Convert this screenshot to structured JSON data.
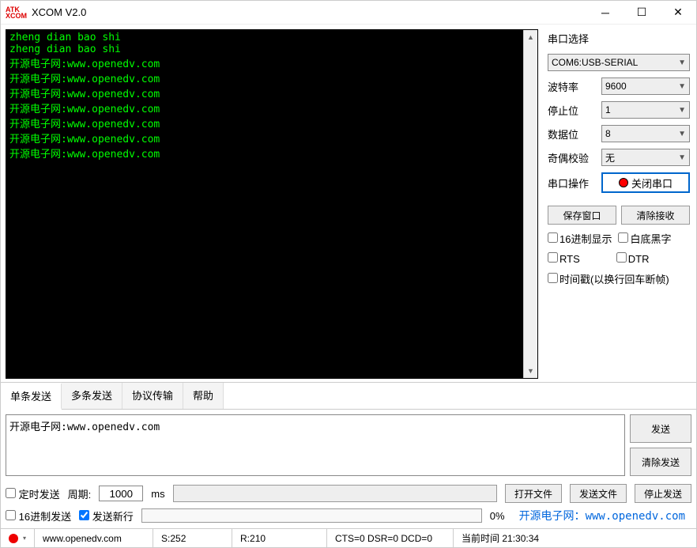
{
  "window": {
    "title": "XCOM V2.0",
    "logo_top": "ATK",
    "logo_bot": "XCOM"
  },
  "terminal_lines": [
    "zheng dian bao shi",
    "zheng dian bao shi",
    "开源电子网:www.openedv.com",
    "开源电子网:www.openedv.com",
    "开源电子网:www.openedv.com",
    "开源电子网:www.openedv.com",
    "开源电子网:www.openedv.com",
    "开源电子网:www.openedv.com",
    "开源电子网:www.openedv.com"
  ],
  "sidebar": {
    "title": "串口选择",
    "port": "COM6:USB-SERIAL",
    "baud_label": "波特率",
    "baud": "9600",
    "stop_label": "停止位",
    "stop": "1",
    "data_label": "数据位",
    "data": "8",
    "parity_label": "奇偶校验",
    "parity": "无",
    "op_label": "串口操作",
    "op_btn": "关闭串口",
    "save_btn": "保存窗口",
    "clear_rx_btn": "清除接收",
    "hex_disp": "16进制显示",
    "white_bg": "白底黑字",
    "rts": "RTS",
    "dtr": "DTR",
    "timestamp": "时间戳(以换行回车断帧)"
  },
  "tabs": {
    "single": "单条发送",
    "multi": "多条发送",
    "proto": "协议传输",
    "help": "帮助"
  },
  "send": {
    "text": "开源电子网:www.openedv.com",
    "send_btn": "发送",
    "clear_btn": "清除发送",
    "timed": "定时发送",
    "period_label": "周期:",
    "period": "1000",
    "ms": "ms",
    "open_file": "打开文件",
    "send_file": "发送文件",
    "stop_send": "停止发送",
    "hex_send": "16进制发送",
    "newline": "发送新行",
    "progress_pct": "0%",
    "link_cn": "开源电子网：",
    "link_url": "www.openedv.com"
  },
  "status": {
    "url": "www.openedv.com",
    "s": "S:252",
    "r": "R:210",
    "sig": "CTS=0 DSR=0 DCD=0",
    "time_label": "当前时间",
    "time": "21:30:34"
  }
}
